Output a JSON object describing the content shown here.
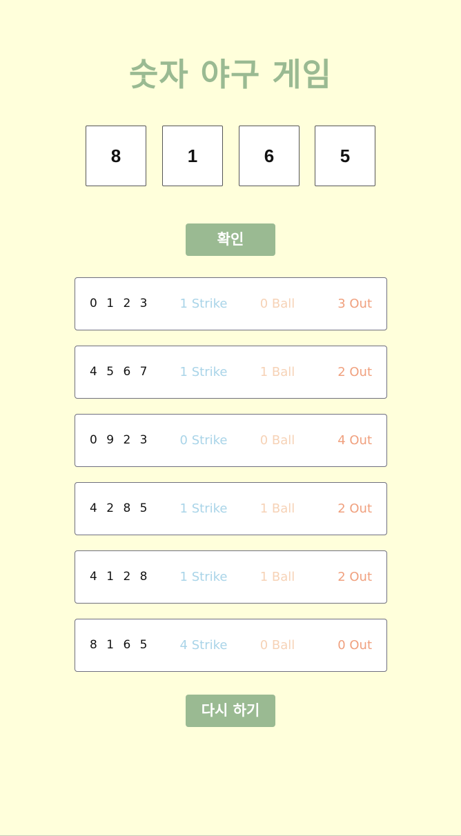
{
  "title": "숫자 야구 게임",
  "digits": [
    "8",
    "1",
    "6",
    "5"
  ],
  "confirm_label": "확인",
  "results": [
    {
      "guess": "0 1 2 3",
      "strike": "1 Strike",
      "ball": "0 Ball",
      "out": "3 Out"
    },
    {
      "guess": "4 5 6 7",
      "strike": "1 Strike",
      "ball": "1 Ball",
      "out": "2 Out"
    },
    {
      "guess": "0 9 2 3",
      "strike": "0 Strike",
      "ball": "0 Ball",
      "out": "4 Out"
    },
    {
      "guess": "4 2 8 5",
      "strike": "1 Strike",
      "ball": "1 Ball",
      "out": "2 Out"
    },
    {
      "guess": "4 1 2 8",
      "strike": "1 Strike",
      "ball": "1 Ball",
      "out": "2 Out"
    },
    {
      "guess": "8 1 6 5",
      "strike": "4 Strike",
      "ball": "0 Ball",
      "out": "0 Out"
    }
  ],
  "restart_label": "다시 하기",
  "colors": {
    "background": "#ffffdb",
    "accent": "#9aba92",
    "strike": "#a9d4e8",
    "ball": "#f6d2b6",
    "out": "#f0a07e"
  }
}
